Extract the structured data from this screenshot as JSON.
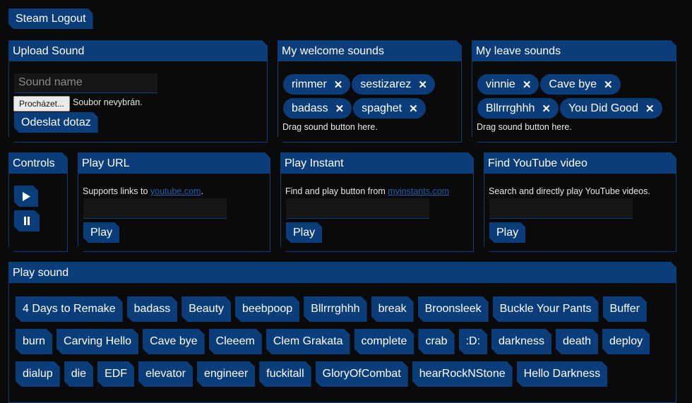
{
  "header": {
    "logout_label": "Steam Logout"
  },
  "upload": {
    "title": "Upload Sound",
    "name_placeholder": "Sound name",
    "browse_label": "Procházet...",
    "file_status": "Soubor nevybrán.",
    "submit_label": "Odeslat dotaz"
  },
  "welcome": {
    "title": "My welcome sounds",
    "tags": [
      "rimmer",
      "sestizarez",
      "badass",
      "spaghet"
    ],
    "hint": "Drag sound button here."
  },
  "leave": {
    "title": "My leave sounds",
    "tags": [
      "vinnie",
      "Cave bye",
      "Bllrrrghhh",
      "You Did Good"
    ],
    "hint": "Drag sound button here."
  },
  "controls": {
    "title": "Controls",
    "play_icon": "play-icon",
    "pause_icon": "pause-icon"
  },
  "play_url": {
    "title": "Play URL",
    "desc": "Supports links to ",
    "link": "youtube.com",
    "desc_end": ".",
    "play_label": "Play"
  },
  "play_instant": {
    "title": "Play Instant",
    "desc": "Find and play button from ",
    "link": "myinstants.com",
    "play_label": "Play"
  },
  "youtube": {
    "title": "Find YouTube video",
    "desc": "Search and directly play YouTube videos.",
    "play_label": "Play"
  },
  "play_sound": {
    "title": "Play sound",
    "sounds": [
      "4 Days to Remake",
      "badass",
      "Beauty",
      "beebpoop",
      "Bllrrrghhh",
      "break",
      "Broonsleek",
      "Buckle Your Pants",
      "Buffer",
      "burn",
      "Carving Hello",
      "Cave bye",
      "Cleeem",
      "Clem Grakata",
      "complete",
      "crab",
      ":D:",
      "darkness",
      "death",
      "deploy",
      "dialup",
      "die",
      "EDF",
      "elevator",
      "engineer",
      "fuckitall",
      "GloryOfCombat",
      "hearRockNStone",
      "Hello Darkness"
    ]
  },
  "colors": {
    "accent": "#0b3d7a",
    "background": "#0a0a0a",
    "link": "#1f5fae"
  }
}
